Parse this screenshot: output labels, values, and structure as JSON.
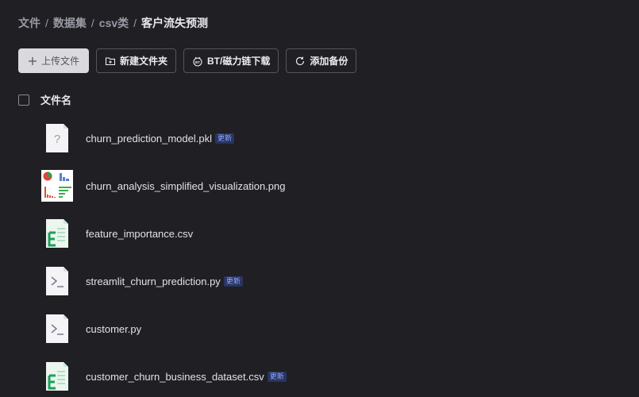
{
  "breadcrumb": {
    "items": [
      "文件",
      "数据集",
      "csv类"
    ],
    "current": "客户流失预测",
    "separator": "/"
  },
  "toolbar": {
    "upload_label": "上传文件",
    "new_folder_label": "新建文件夹",
    "bt_label": "BT/磁力链下载",
    "backup_label": "添加备份"
  },
  "list": {
    "header_label": "文件名",
    "files": [
      {
        "name": "churn_prediction_model.pkl",
        "badge": "更新",
        "icon": "unknown-file-icon"
      },
      {
        "name": "churn_analysis_simplified_visualization.png",
        "badge": "",
        "icon": "image-thumbnail-icon"
      },
      {
        "name": "feature_importance.csv",
        "badge": "",
        "icon": "spreadsheet-file-icon"
      },
      {
        "name": "streamlit_churn_prediction.py",
        "badge": "更新",
        "icon": "code-file-icon"
      },
      {
        "name": "customer.py",
        "badge": "",
        "icon": "code-file-icon"
      },
      {
        "name": "customer_churn_business_dataset.csv",
        "badge": "更新",
        "icon": "spreadsheet-file-icon"
      }
    ]
  },
  "colors": {
    "background": "#1f1f24",
    "badge_text": "#8fa8ff",
    "badge_bg": "#2a3460",
    "csv_green": "#1e9e5a"
  }
}
